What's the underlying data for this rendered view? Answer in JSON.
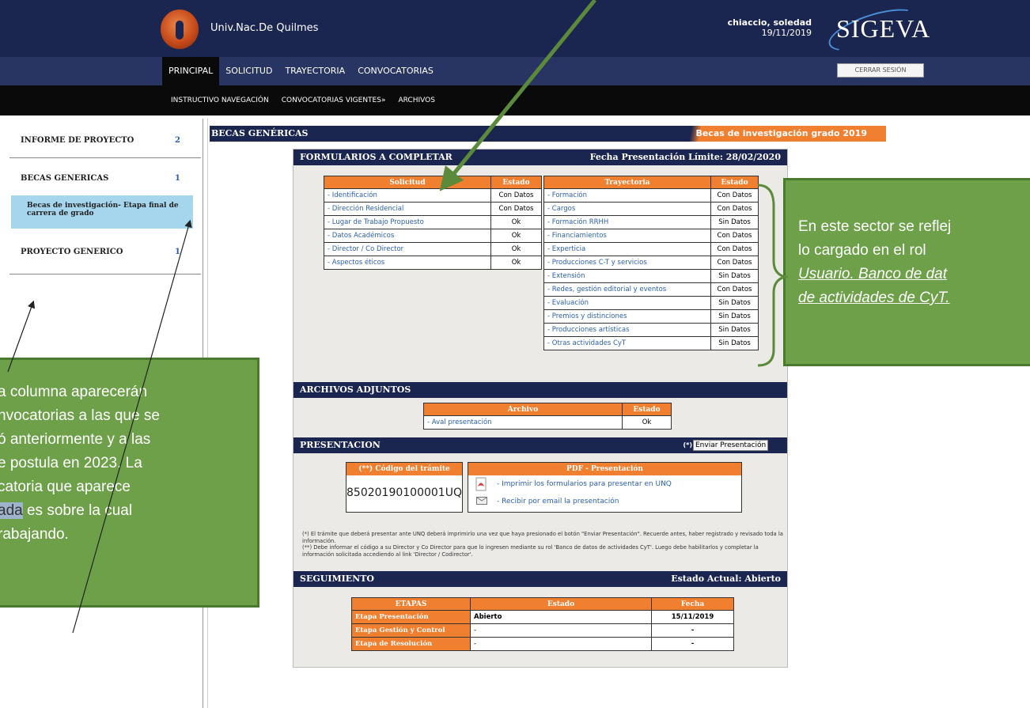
{
  "header": {
    "univ": "Univ.Nac.De Quilmes",
    "user_name": "chiaccio, soledad",
    "user_date": "19/11/2019",
    "brand": "SIGEVA",
    "logout": "CERRAR SESIÓN"
  },
  "main_nav": [
    "PRINCIPAL",
    "SOLICITUD",
    "TRAYECTORIA",
    "CONVOCATORIAS"
  ],
  "sub_nav": [
    "INSTRUCTIVO NAVEGACIÓN",
    "CONVOCATORIAS VIGENTES»",
    "ARCHIVOS"
  ],
  "sidebar": {
    "items": [
      {
        "label": "INFORME DE PROYECTO",
        "count": "2"
      },
      {
        "label": "BECAS GENERICAS",
        "count": "1"
      },
      {
        "label": "PROYECTO GENERICO",
        "count": "1"
      }
    ],
    "selected": "Becas de investigación- Etapa final de carrera de grado"
  },
  "page": {
    "title": "BECAS GENÉRICAS",
    "subtitle": "Becas de investigación grado 2019"
  },
  "forms": {
    "title": "FORMULARIOS A COMPLETAR",
    "deadline": "Fecha Presentación Límite: 28/02/2020",
    "sol_head": [
      "Solicitud",
      "Estado"
    ],
    "sol_rows": [
      [
        "Identificación",
        "Con Datos"
      ],
      [
        "Dirección Residencial",
        "Con Datos"
      ],
      [
        "Lugar de Trabajo Propuesto",
        "Ok"
      ],
      [
        "Datos Académicos",
        "Ok"
      ],
      [
        "Director / Co Director",
        "Ok"
      ],
      [
        "Aspectos éticos",
        "Ok"
      ]
    ],
    "tray_head": [
      "Trayectoria",
      "Estado"
    ],
    "tray_rows": [
      [
        "Formación",
        "Con Datos"
      ],
      [
        "Cargos",
        "Con Datos"
      ],
      [
        "Formación RRHH",
        "Sin Datos"
      ],
      [
        "Financiamientos",
        "Con Datos"
      ],
      [
        "Experticia",
        "Con Datos"
      ],
      [
        "Producciones C-T y servicios",
        "Con Datos"
      ],
      [
        "Extensión",
        "Sin Datos"
      ],
      [
        "Redes, gestión editorial y eventos",
        "Con Datos"
      ],
      [
        "Evaluación",
        "Sin Datos"
      ],
      [
        "Premios y distinciones",
        "Sin Datos"
      ],
      [
        "Producciones artísticas",
        "Sin Datos"
      ],
      [
        "Otras actividades CyT",
        "Sin Datos"
      ]
    ]
  },
  "attach": {
    "title": "ARCHIVOS ADJUNTOS",
    "head": [
      "Archivo",
      "Estado"
    ],
    "rows": [
      [
        "Aval presentación",
        "Ok"
      ]
    ]
  },
  "present": {
    "title": "PRESENTACION",
    "send_note": "(*)",
    "send_button": "Enviar Presentación",
    "code_head": "(**) Código del trámite",
    "code": "85020190100001UQ",
    "pdf_head": "PDF - Presentación",
    "pdf_print": "- Imprimir los formularios para presentar en UNQ",
    "pdf_email": "- Recibir por email la presentación",
    "note": "(*) El trámite que deberá presentar ante UNQ deberá imprimirlo una vez que haya presionado el botón \"Enviar Presentación\". Recuerde antes, haber registrado y revisado toda la información.\n(**) Debe informar el código a su Director y Co Director para que lo ingresen mediante su rol 'Banco de datos de actividades CyT'. Luego debe habilitarlos y completar la información solicitada accediendo al link 'Director / Codirector'."
  },
  "tracking": {
    "title": "SEGUIMIENTO",
    "status": "Estado Actual: Abierto",
    "head": [
      "ETAPAS",
      "Estado",
      "Fecha"
    ],
    "rows": [
      [
        "Etapa Presentación",
        "Abierto",
        "15/11/2019"
      ],
      [
        "Etapa Gestión y Control",
        "-",
        "-"
      ],
      [
        "Etapa de Resolución",
        "-",
        "-"
      ]
    ]
  },
  "callout_left": {
    "l1": "a columna aparecerán",
    "l2": "nvocatorias a las que se",
    "l3": "ó anteriormente y a las",
    "l4": "e postula en 2023.  La",
    "l5": "catoria que aparece",
    "l6_hl": "ada",
    "l6_rest": " es sobre la cual",
    "l7": "rabajando."
  },
  "callout_right": {
    "l1": "En este sector se reflej",
    "l2": "lo cargado en el rol",
    "l3": "Usuario. Banco de dat",
    "l4": "de actividades de CyT."
  }
}
